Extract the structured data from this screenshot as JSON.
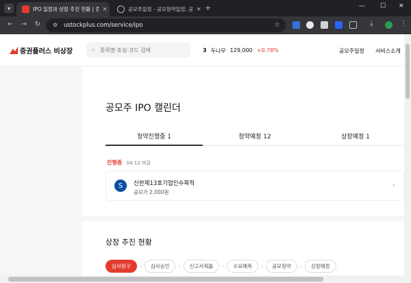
{
  "browser": {
    "tabs": [
      {
        "title": "IPO 일정과 상장 추진 현황 | 증권플러스 비상장",
        "active": true
      },
      {
        "title": "공모주일정 - 공모청약일정, 공모주 청약",
        "active": false
      }
    ],
    "url": "ustockplus.com/service/ipo"
  },
  "header": {
    "logo_text": "증권플러스 비상장",
    "search_placeholder": "종목명·초성·코드 검색",
    "ticker": {
      "rank": "3",
      "name": "두나무",
      "price": "129,000",
      "change": "+0.78%"
    },
    "nav": [
      "공모주일정",
      "서비스소개"
    ]
  },
  "calendar": {
    "title": "공모주 IPO 캘린더",
    "tabs": [
      {
        "label": "청약진행중 1",
        "active": true
      },
      {
        "label": "청약예정 12",
        "active": false
      },
      {
        "label": "상장예정 1",
        "active": false
      }
    ],
    "status_label": "진행중",
    "status_date": "04.12 마감",
    "item": {
      "name": "신한제13호기업인수목적",
      "price": "공모가 2,000원",
      "logo_glyph": "S"
    }
  },
  "listing": {
    "title": "상장 추진 현황",
    "steps": [
      {
        "label": "심사청구",
        "active": true
      },
      {
        "label": "심사승인",
        "active": false
      },
      {
        "label": "신고서제출",
        "active": false
      },
      {
        "label": "수요예측",
        "active": false
      },
      {
        "label": "공모청약",
        "active": false
      },
      {
        "label": "상장예정",
        "active": false
      }
    ]
  },
  "colors": {
    "accent": "#e23b2e",
    "chrome_dark": "#202124",
    "bg": "#f5f6f8"
  }
}
